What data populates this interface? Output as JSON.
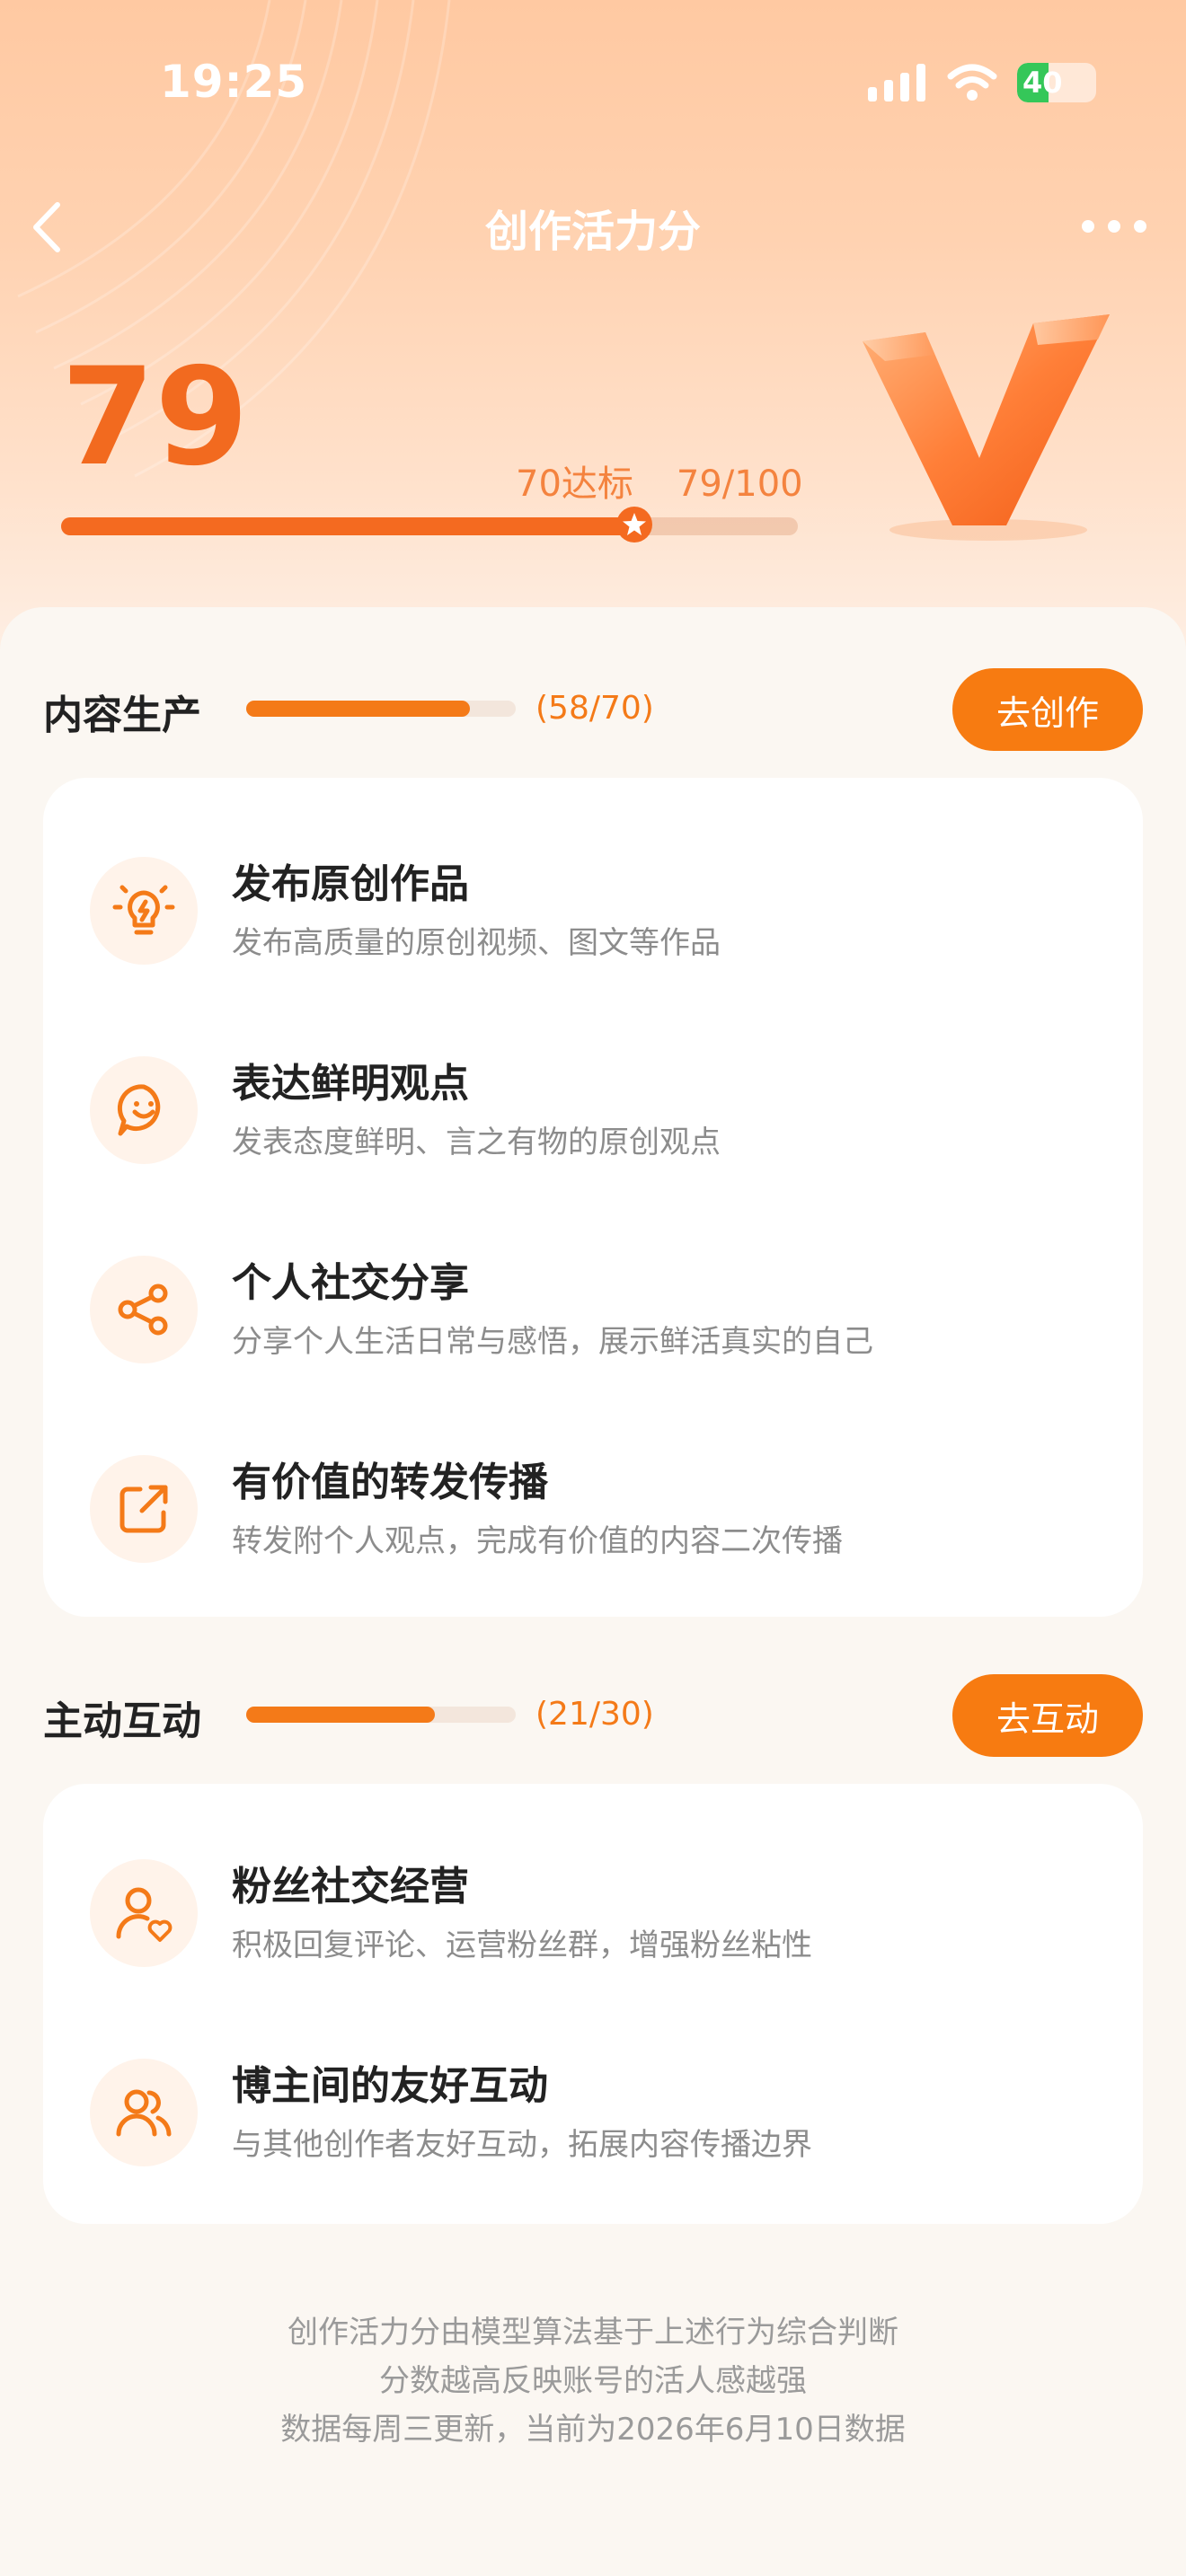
{
  "status_bar": {
    "time": "19:25",
    "battery": "40",
    "battery_level": 0.4
  },
  "nav": {
    "title": "创作活力分"
  },
  "score": {
    "value": "79",
    "target_label": "70达标",
    "progress_label": "79/100",
    "progress": 0.79,
    "target": 0.7
  },
  "sections": [
    {
      "title": "内容生产",
      "count": "(58/70)",
      "progress": 0.829,
      "button": "去创作",
      "items": [
        {
          "title": "发布原创作品",
          "desc": "发布高质量的原创视频、图文等作品",
          "icon": "lightbulb-icon"
        },
        {
          "title": "表达鲜明观点",
          "desc": "发表态度鲜明、言之有物的原创观点",
          "icon": "speech-bubble-smile-icon"
        },
        {
          "title": "个人社交分享",
          "desc": "分享个人生活日常与感悟，展示鲜活真实的自己",
          "icon": "share-icon"
        },
        {
          "title": "有价值的转发传播",
          "desc": "转发附个人观点，完成有价值的内容二次传播",
          "icon": "forward-icon"
        }
      ]
    },
    {
      "title": "主动互动",
      "count": "(21/30)",
      "progress": 0.7,
      "button": "去互动",
      "items": [
        {
          "title": "粉丝社交经营",
          "desc": "积极回复评论、运营粉丝群，增强粉丝粘性",
          "icon": "user-heart-icon"
        },
        {
          "title": "博主间的友好互动",
          "desc": "与其他创作者友好互动，拓展内容传播边界",
          "icon": "users-icon"
        }
      ]
    }
  ],
  "footer": {
    "line1": "创作活力分由模型算法基于上述行为综合判断",
    "line2": "分数越高反映账号的活人感越强",
    "line3": "数据每周三更新，当前为2026年6月10日数据"
  },
  "colors": {
    "accent": "#f77b11",
    "score": "#f26a1f",
    "hero_top": "#ffc9a2"
  }
}
